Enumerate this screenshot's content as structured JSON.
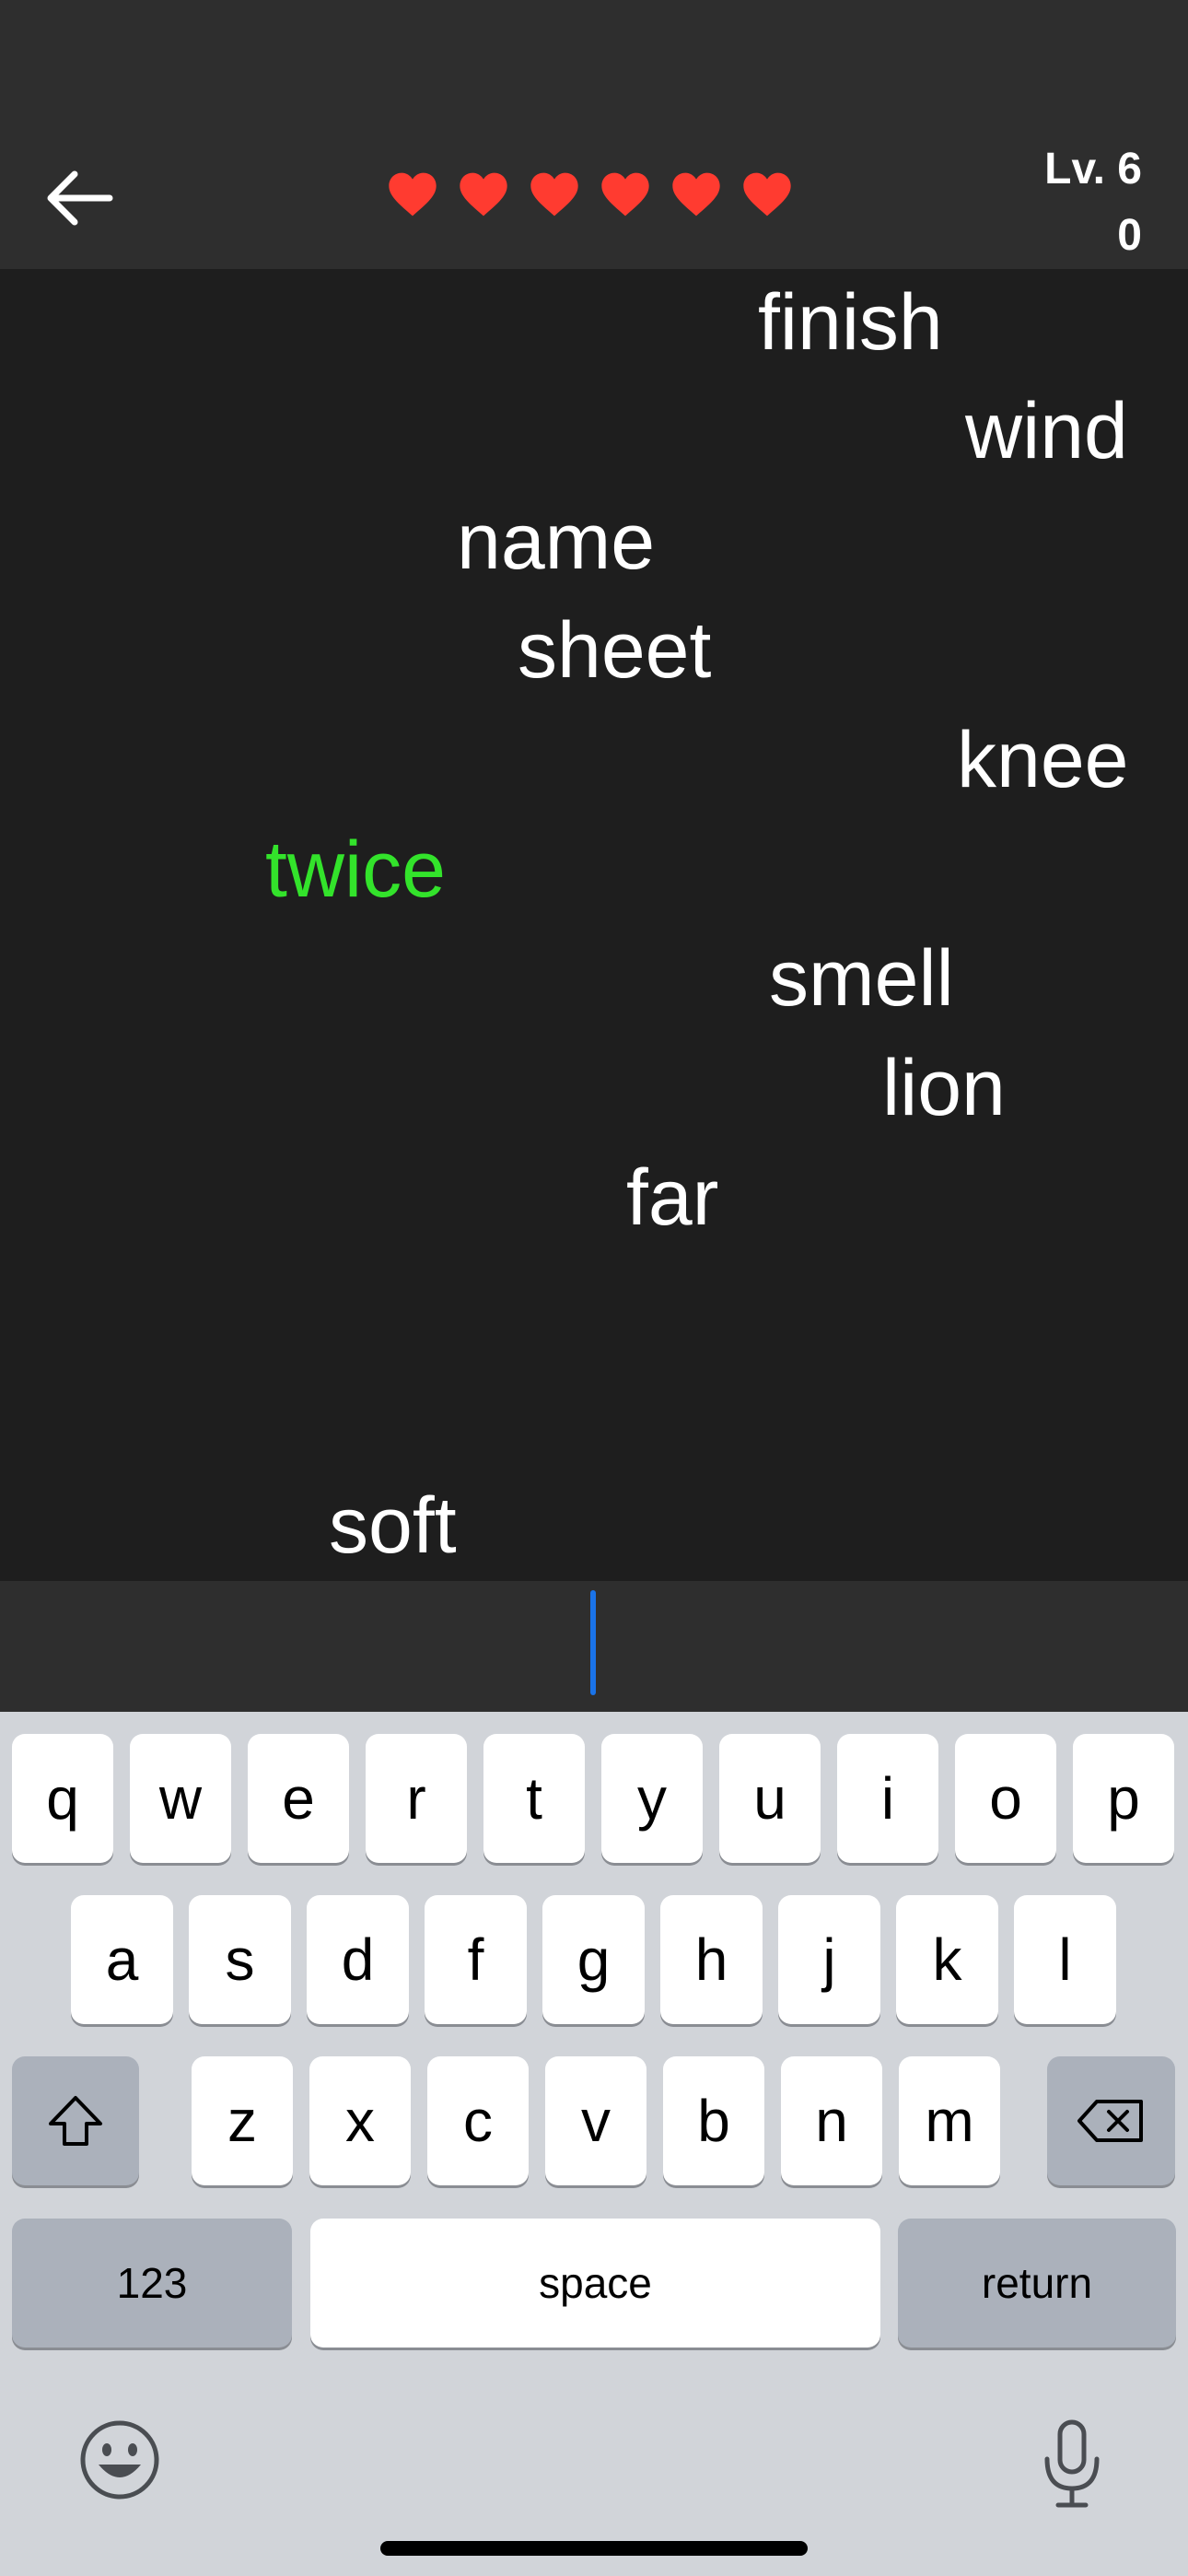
{
  "header": {
    "lives": 6,
    "heart_color": "#ff3b30",
    "level_label": "Lv. 6",
    "score": "0",
    "back_icon": "arrow-left-icon"
  },
  "words": [
    {
      "text": "finish",
      "color": "#ffffff"
    },
    {
      "text": "wind",
      "color": "#ffffff"
    },
    {
      "text": "name",
      "color": "#ffffff"
    },
    {
      "text": "sheet",
      "color": "#ffffff"
    },
    {
      "text": "knee",
      "color": "#ffffff"
    },
    {
      "text": "twice",
      "color": "#33e32b"
    },
    {
      "text": "smell",
      "color": "#ffffff"
    },
    {
      "text": "lion",
      "color": "#ffffff"
    },
    {
      "text": "far",
      "color": "#ffffff"
    },
    {
      "text": "soft",
      "color": "#ffffff"
    }
  ],
  "input": {
    "value": "",
    "cursor_color": "#1a73e8"
  },
  "keyboard": {
    "row1": [
      "q",
      "w",
      "e",
      "r",
      "t",
      "y",
      "u",
      "i",
      "o",
      "p"
    ],
    "row2": [
      "a",
      "s",
      "d",
      "f",
      "g",
      "h",
      "j",
      "k",
      "l"
    ],
    "row3": [
      "z",
      "x",
      "c",
      "v",
      "b",
      "n",
      "m"
    ],
    "numbers_label": "123",
    "space_label": "space",
    "return_label": "return",
    "shift_icon": "shift-icon",
    "delete_icon": "backspace-icon",
    "emoji_icon": "emoji-icon",
    "mic_icon": "microphone-icon"
  }
}
